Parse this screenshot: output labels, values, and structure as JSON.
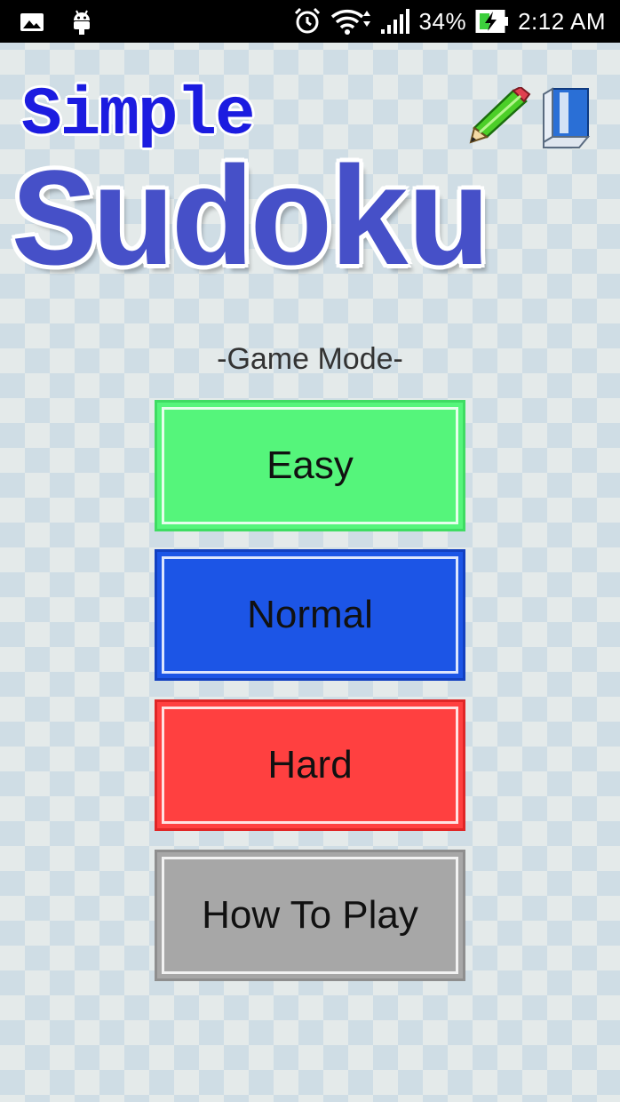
{
  "status_bar": {
    "battery": "34%",
    "time": "2:12 AM",
    "icons": [
      "gallery-icon",
      "android-icon",
      "alarm-icon",
      "wifi-icon",
      "signal-icon",
      "battery-charging-icon"
    ]
  },
  "title": {
    "line1": "Simple",
    "line2": "Sudoku",
    "icons": [
      "pencil-icon",
      "eraser-icon"
    ]
  },
  "game_mode": {
    "label": "-Game Mode-",
    "buttons": [
      {
        "label": "Easy",
        "color": "#55f57b"
      },
      {
        "label": "Normal",
        "color": "#1c55e6"
      },
      {
        "label": "Hard",
        "color": "#ff4040"
      },
      {
        "label": "How To Play",
        "color": "#a7a7a7"
      }
    ]
  },
  "colors": {
    "title_simple": "#1c1ce0",
    "title_sudoku": "#4650c8",
    "checker": "#cfdde5"
  }
}
